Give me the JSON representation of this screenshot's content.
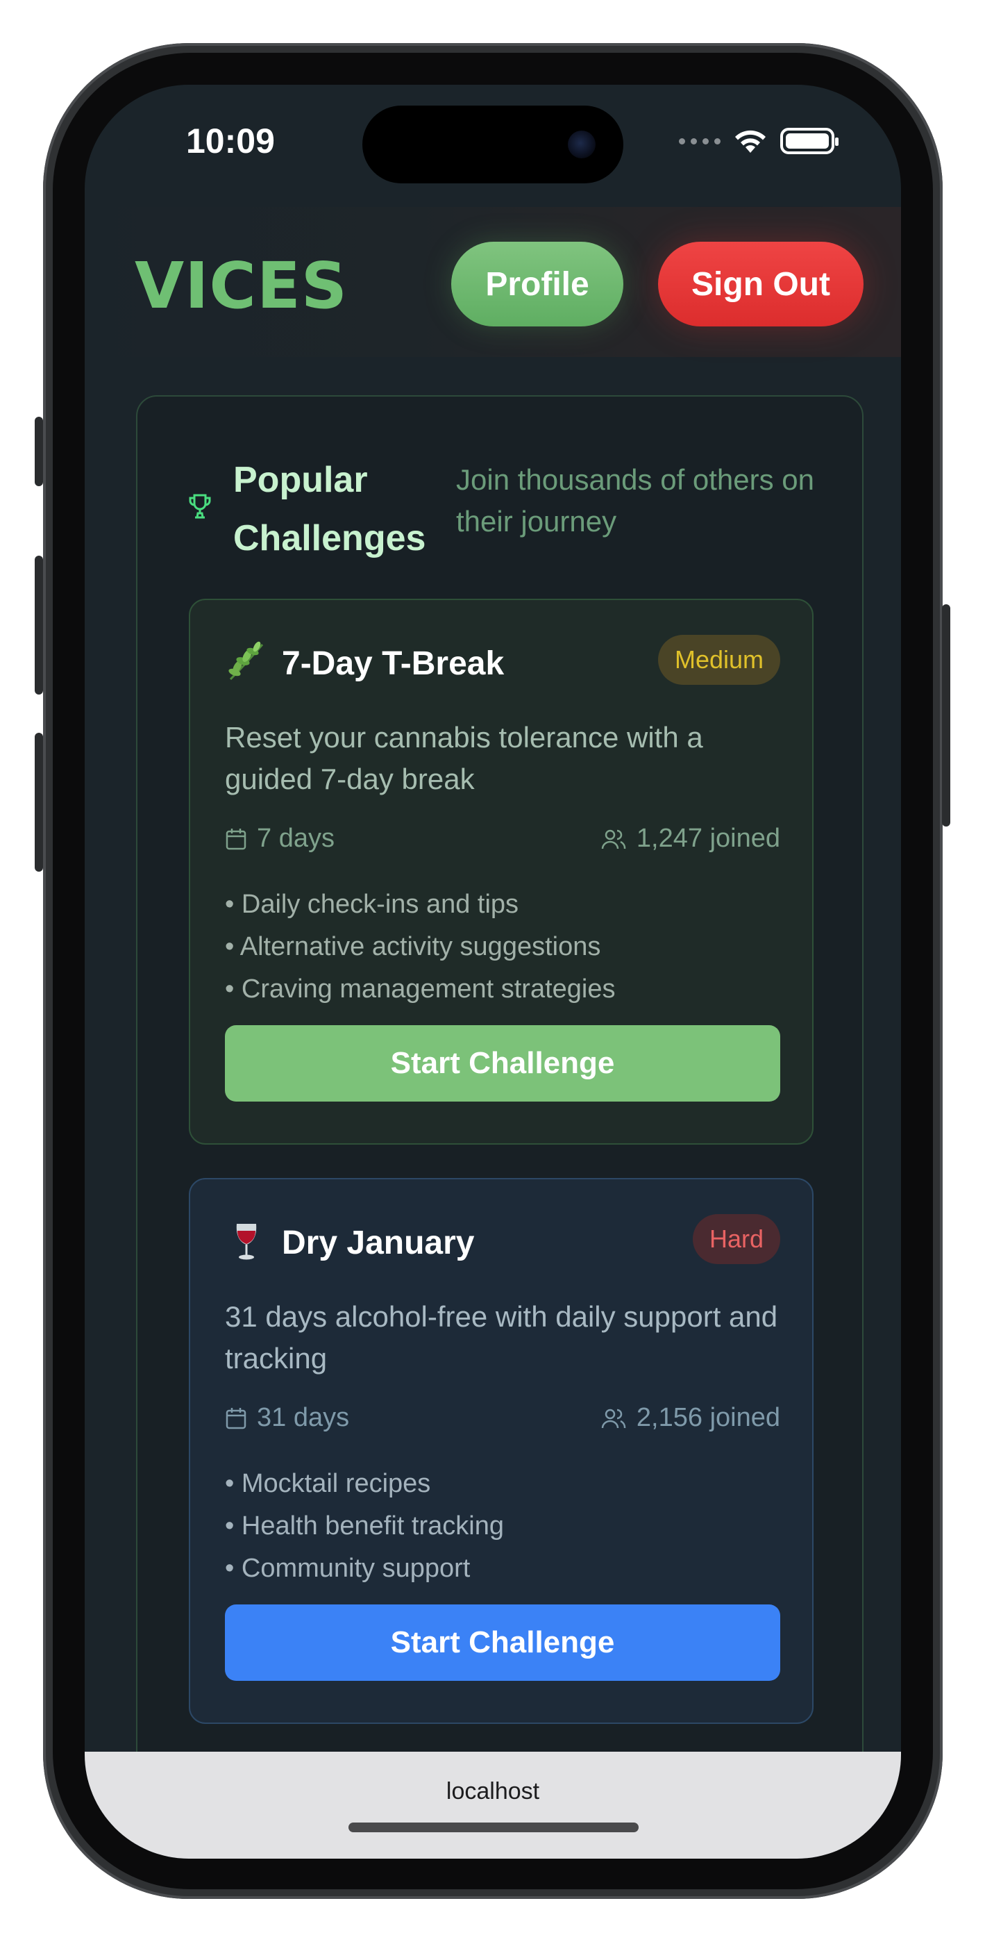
{
  "status_bar": {
    "time": "10:09"
  },
  "header": {
    "logo": "VICES",
    "profile_label": "Profile",
    "signout_label": "Sign Out"
  },
  "section": {
    "title": "Popular Challenges",
    "subtitle": "Join thousands of others on their journey"
  },
  "challenges": [
    {
      "emoji_icon": "herb-icon",
      "title": "7-Day T-Break",
      "difficulty": "Medium",
      "description": "Reset your cannabis tolerance with a guided 7-day break",
      "duration": "7 days",
      "joined": "1,247 joined",
      "features": [
        "Daily check-ins and tips",
        "Alternative activity suggestions",
        "Craving management strategies"
      ],
      "cta": "Start Challenge",
      "accent": "#7cc279"
    },
    {
      "emoji_icon": "wine-glass-icon",
      "title": "Dry January",
      "difficulty": "Hard",
      "description": "31 days alcohol-free with daily support and tracking",
      "duration": "31 days",
      "joined": "2,156 joined",
      "features": [
        "Mocktail recipes",
        "Health benefit tracking",
        "Community support"
      ],
      "cta": "Start Challenge",
      "accent": "#3b82f6"
    }
  ],
  "browser": {
    "url": "localhost"
  },
  "colors": {
    "background": "#1b242a",
    "brand_green": "#6fbf73",
    "signout_red": "#ef4444",
    "medium_badge": "#e0c12a",
    "hard_badge": "#e96363"
  }
}
